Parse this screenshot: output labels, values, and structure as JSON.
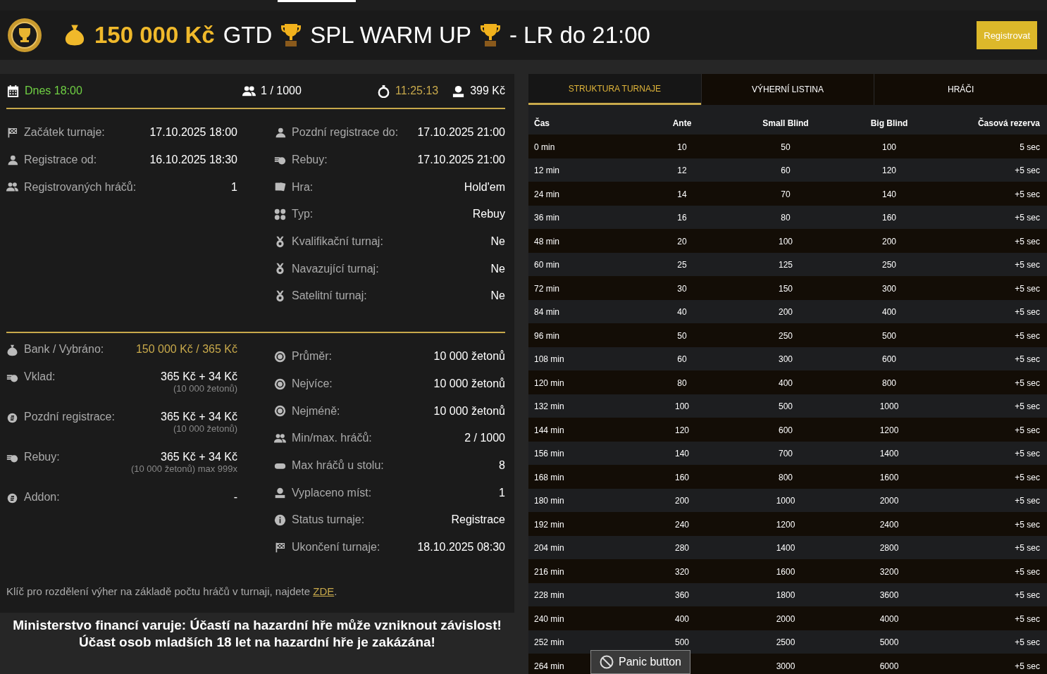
{
  "header": {
    "amount": "150 000 Kč",
    "title_1": "GTD",
    "title_2": "SPL WARM UP",
    "title_3": "- LR do 21:00",
    "register_button": "Registrovat"
  },
  "summary": {
    "date": "Dnes 18:00",
    "players": "1 / 1000",
    "timer": "11:25:13",
    "price": "399 Kč"
  },
  "details_left": [
    {
      "label": "Začátek turnaje:",
      "value": "17.10.2025 18:00"
    },
    {
      "label": "Registrace od:",
      "value": "16.10.2025 18:30"
    },
    {
      "label": "Registrovaných hráčů:",
      "value": "1"
    }
  ],
  "details_right": [
    {
      "label": "Pozdní registrace do:",
      "value": "17.10.2025 21:00"
    },
    {
      "label": "Rebuy:",
      "value": "17.10.2025 21:00"
    },
    {
      "label": "Hra:",
      "value": "Hold'em"
    },
    {
      "label": "Typ:",
      "value": "Rebuy"
    },
    {
      "label": "Kvalifikační turnaj:",
      "value": "Ne"
    },
    {
      "label": "Navazující turnaj:",
      "value": "Ne"
    },
    {
      "label": "Satelitní turnaj:",
      "value": "Ne"
    }
  ],
  "money_left": [
    {
      "label": "Bank / Vybráno:",
      "value": "150 000 Kč / 365 Kč"
    },
    {
      "label": "Vklad:",
      "value": "365 Kč + 34 Kč",
      "sub": "(10 000 žetonů)"
    },
    {
      "label": "Pozdní registrace:",
      "value": "365 Kč + 34 Kč",
      "sub": "(10 000 žetonů)"
    },
    {
      "label": "Rebuy:",
      "value": "365 Kč + 34 Kč",
      "sub": "(10 000 žetonů) max 999x"
    },
    {
      "label": "Addon:",
      "value": "-"
    }
  ],
  "stats_right": [
    {
      "label": "Průměr:",
      "value": "10 000 žetonů"
    },
    {
      "label": "Nejvíce:",
      "value": "10 000 žetonů"
    },
    {
      "label": "Nejméně:",
      "value": "10 000 žetonů"
    },
    {
      "label": "Min/max. hráčů:",
      "value": "2 / 1000"
    },
    {
      "label": "Max hráčů u stolu:",
      "value": "8"
    },
    {
      "label": "Vyplaceno míst:",
      "value": "1"
    },
    {
      "label": "Status turnaje:",
      "value": "Registrace"
    },
    {
      "label": "Ukončení turnaje:",
      "value": "18.10.2025 08:30"
    }
  ],
  "note": {
    "text": "Klíč pro rozdělení výher na základě počtu hráčů v turnaji, najdete",
    "link": "ZDE",
    "end": "."
  },
  "warning": "Ministerstvo financí varuje: Účastí na hazardní hře může vzniknout závislost! Účast osob mladších 18 let na hazardní hře je zakázána!",
  "tabs": [
    {
      "label": "STRUKTURA TURNAJE",
      "selected": true
    },
    {
      "label": "VÝHERNÍ LISTINA",
      "selected": false
    },
    {
      "label": "HRÁČI",
      "selected": false
    }
  ],
  "table": {
    "columns": [
      "Čas",
      "Ante",
      "Small Blind",
      "Big Blind",
      "Časová rezerva"
    ],
    "rows": [
      [
        "0 min",
        "10",
        "50",
        "100",
        "5 sec"
      ],
      [
        "12 min",
        "12",
        "60",
        "120",
        "+5 sec"
      ],
      [
        "24 min",
        "14",
        "70",
        "140",
        "+5 sec"
      ],
      [
        "36 min",
        "16",
        "80",
        "160",
        "+5 sec"
      ],
      [
        "48 min",
        "20",
        "100",
        "200",
        "+5 sec"
      ],
      [
        "60 min",
        "25",
        "125",
        "250",
        "+5 sec"
      ],
      [
        "72 min",
        "30",
        "150",
        "300",
        "+5 sec"
      ],
      [
        "84 min",
        "40",
        "200",
        "400",
        "+5 sec"
      ],
      [
        "96 min",
        "50",
        "250",
        "500",
        "+5 sec"
      ],
      [
        "108 min",
        "60",
        "300",
        "600",
        "+5 sec"
      ],
      [
        "120 min",
        "80",
        "400",
        "800",
        "+5 sec"
      ],
      [
        "132 min",
        "100",
        "500",
        "1000",
        "+5 sec"
      ],
      [
        "144 min",
        "120",
        "600",
        "1200",
        "+5 sec"
      ],
      [
        "156 min",
        "140",
        "700",
        "1400",
        "+5 sec"
      ],
      [
        "168 min",
        "160",
        "800",
        "1600",
        "+5 sec"
      ],
      [
        "180 min",
        "200",
        "1000",
        "2000",
        "+5 sec"
      ],
      [
        "192 min",
        "240",
        "1200",
        "2400",
        "+5 sec"
      ],
      [
        "204 min",
        "280",
        "1400",
        "2800",
        "+5 sec"
      ],
      [
        "216 min",
        "320",
        "1600",
        "3200",
        "+5 sec"
      ],
      [
        "228 min",
        "360",
        "1800",
        "3600",
        "+5 sec"
      ],
      [
        "240 min",
        "400",
        "2000",
        "4000",
        "+5 sec"
      ],
      [
        "252 min",
        "500",
        "2500",
        "5000",
        "+5 sec"
      ],
      [
        "264 min",
        null,
        "3000",
        "6000",
        "+5 sec"
      ]
    ]
  },
  "panic_button": "Panic button"
}
